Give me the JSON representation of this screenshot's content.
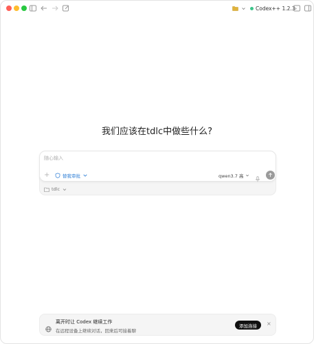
{
  "titlebar": {
    "app_badge": "Codex++ 1.2.3"
  },
  "main": {
    "headline": "我们应该在tdlc中做些什么?"
  },
  "composer": {
    "placeholder": "随心输入",
    "approval_label": "替我审批",
    "model_label": "qwen3.7 高",
    "workspace_label": "tdlc"
  },
  "banner": {
    "title": "离开时让 Codex 继续工作",
    "subtitle": "在远程设备上继续对话，回来后可接着聊",
    "button_label": "添加连接",
    "close_glyph": "×"
  },
  "colors": {
    "accent": "#2f7fd6",
    "status_green": "#3cc48a",
    "close": "#ff5f57",
    "minimize": "#febc2e",
    "maximize": "#28c840"
  }
}
